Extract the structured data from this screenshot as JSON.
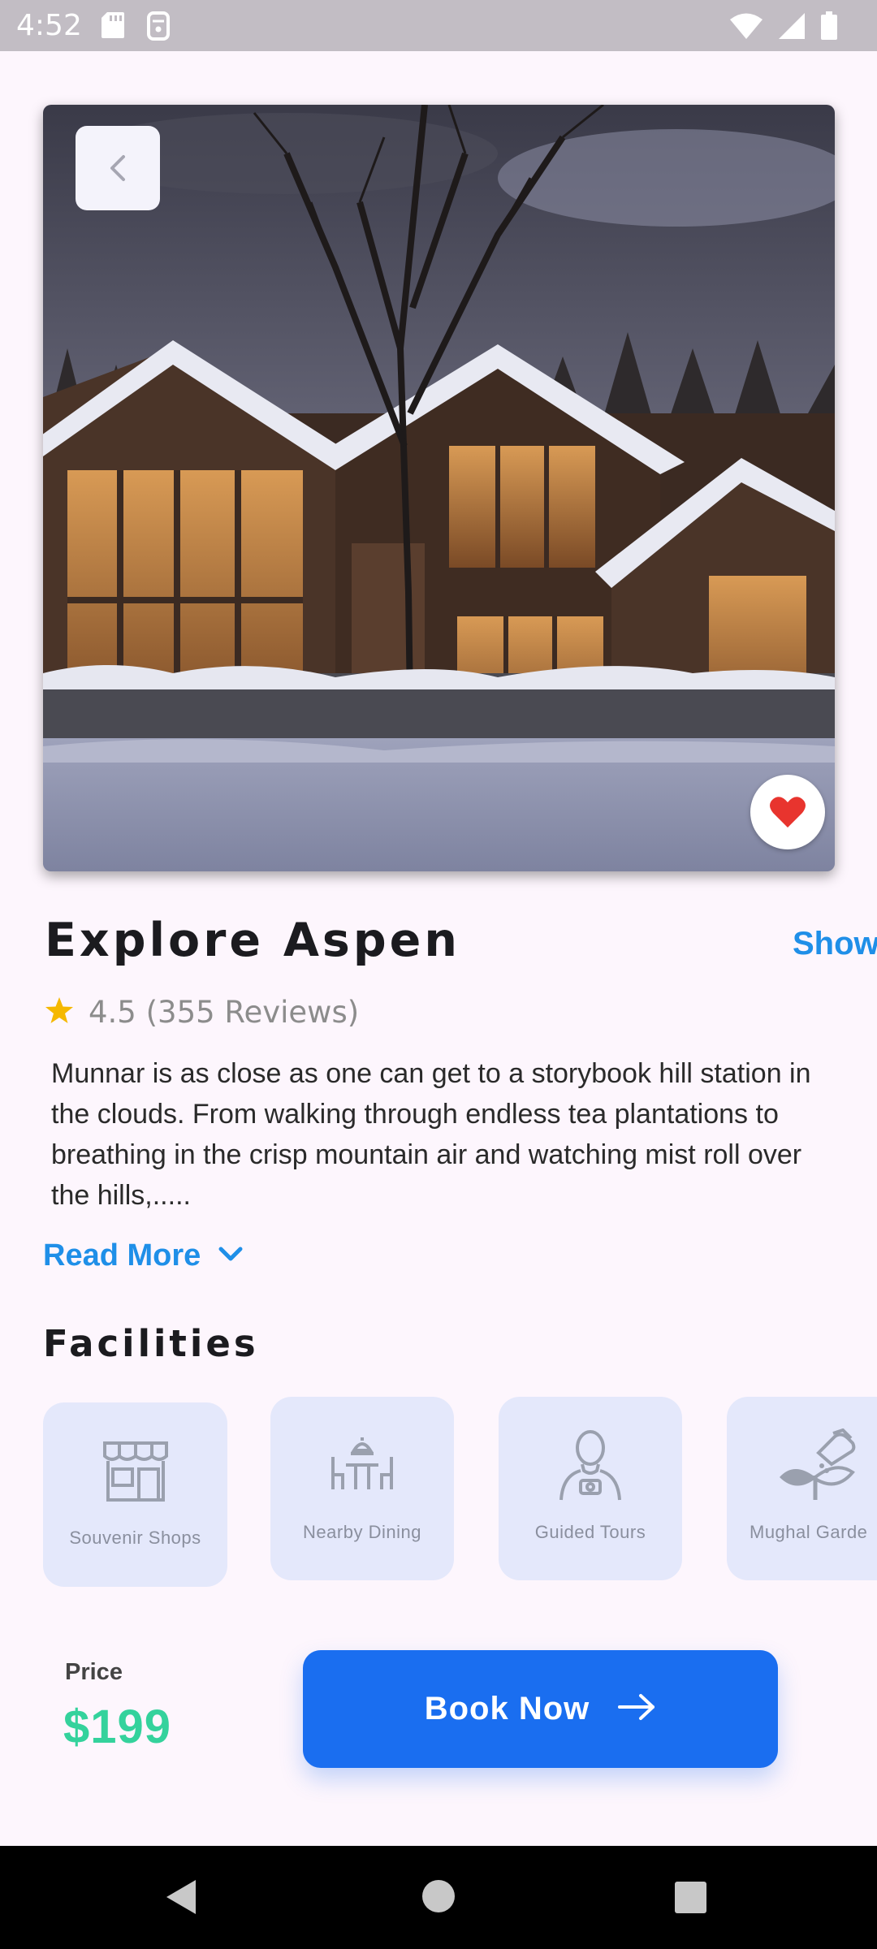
{
  "status_bar": {
    "time": "4:52",
    "icons_left": [
      "sd-card-icon",
      "flashlight-icon"
    ],
    "icons_right": [
      "wifi-icon",
      "cell-signal-icon",
      "battery-icon"
    ]
  },
  "hero": {
    "back_icon": "chevron-left-icon",
    "favorite_icon": "heart-icon",
    "favorite_color": "#e8342e"
  },
  "destination": {
    "title": "Explore Aspen",
    "show_link": "Show",
    "rating": "4.5",
    "reviews": "(355 Reviews)",
    "description": "Munnar is as close as one can get to a storybook hill station in the clouds. From walking through endless tea plantations to breathing in the crisp mountain air and watching mist roll over the hills,.....",
    "read_more": "Read More"
  },
  "facilities": {
    "title": "Facilities",
    "items": [
      {
        "label": "Souvenir Shops",
        "icon": "shop-icon"
      },
      {
        "label": "Nearby Dining",
        "icon": "dining-icon"
      },
      {
        "label": "Guided Tours",
        "icon": "guide-icon"
      },
      {
        "label": "Mughal Garde",
        "icon": "garden-icon"
      }
    ]
  },
  "footer": {
    "price_label": "Price",
    "price_value": "$199",
    "book_label": "Book Now"
  },
  "colors": {
    "accent": "#1a6ef0",
    "link": "#1f8fe8",
    "price": "#34d29c",
    "star": "#f5b800"
  }
}
